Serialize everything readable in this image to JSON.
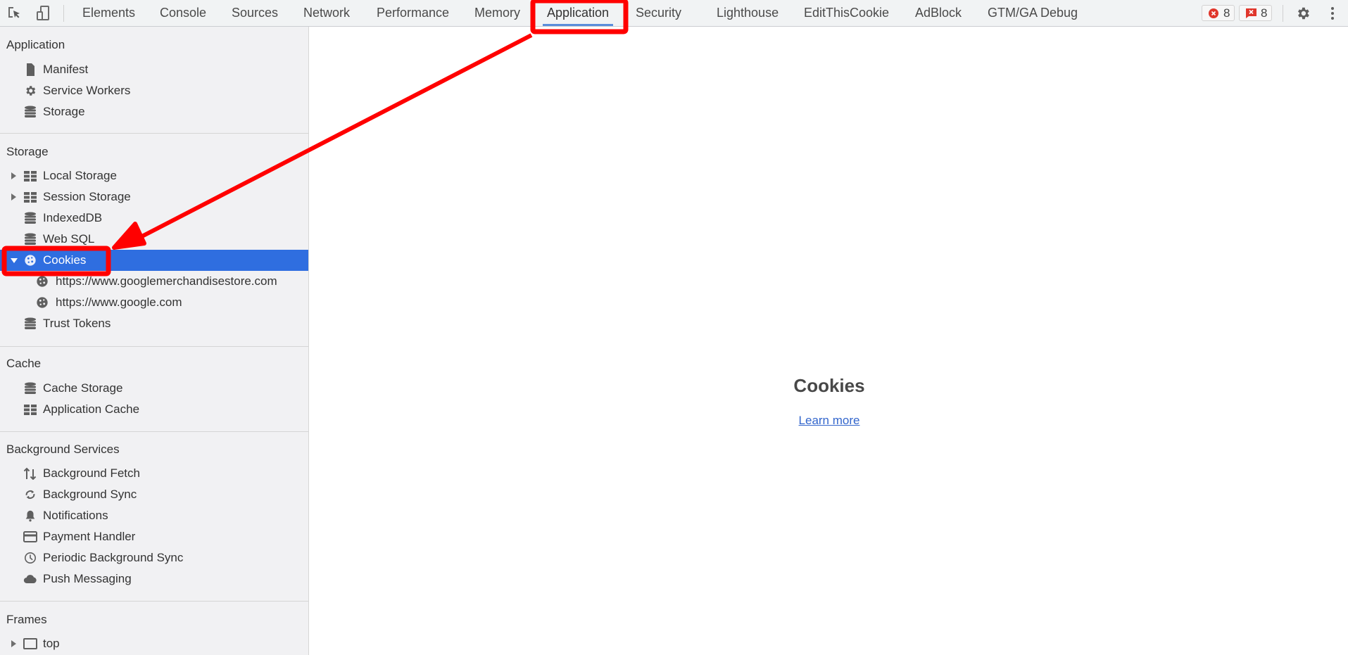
{
  "toolbar": {
    "inspect_icon": "inspect-element-icon",
    "device_icon": "device-toolbar-icon",
    "tabs": [
      {
        "label": "Elements"
      },
      {
        "label": "Console"
      },
      {
        "label": "Sources"
      },
      {
        "label": "Network"
      },
      {
        "label": "Performance"
      },
      {
        "label": "Memory"
      },
      {
        "label": "Application",
        "active": true
      },
      {
        "label": "Security"
      },
      {
        "label": "Lighthouse"
      },
      {
        "label": "EditThisCookie"
      },
      {
        "label": "AdBlock"
      },
      {
        "label": "GTM/GA Debug"
      }
    ],
    "error_count": "8",
    "issue_count": "8",
    "settings_icon": "gear-icon",
    "more_icon": "kebab-menu-icon"
  },
  "sidebar": {
    "sections": [
      {
        "header": "Application",
        "items": [
          {
            "label": "Manifest",
            "icon": "file-icon"
          },
          {
            "label": "Service Workers",
            "icon": "gear-icon"
          },
          {
            "label": "Storage",
            "icon": "database-icon"
          }
        ]
      },
      {
        "header": "Storage",
        "items": [
          {
            "label": "Local Storage",
            "icon": "grid-icon",
            "expandable": true
          },
          {
            "label": "Session Storage",
            "icon": "grid-icon",
            "expandable": true
          },
          {
            "label": "IndexedDB",
            "icon": "database-icon"
          },
          {
            "label": "Web SQL",
            "icon": "database-icon"
          },
          {
            "label": "Cookies",
            "icon": "cookie-icon",
            "expandable": true,
            "expanded": true,
            "selected": true
          },
          {
            "label": "https://www.googlemerchandisestore.com",
            "icon": "cookie-icon",
            "child": true
          },
          {
            "label": "https://www.google.com",
            "icon": "cookie-icon",
            "child": true
          },
          {
            "label": "Trust Tokens",
            "icon": "database-icon"
          }
        ]
      },
      {
        "header": "Cache",
        "items": [
          {
            "label": "Cache Storage",
            "icon": "database-icon"
          },
          {
            "label": "Application Cache",
            "icon": "grid-icon"
          }
        ]
      },
      {
        "header": "Background Services",
        "items": [
          {
            "label": "Background Fetch",
            "icon": "up-down-arrows-icon"
          },
          {
            "label": "Background Sync",
            "icon": "sync-icon"
          },
          {
            "label": "Notifications",
            "icon": "bell-icon"
          },
          {
            "label": "Payment Handler",
            "icon": "credit-card-icon"
          },
          {
            "label": "Periodic Background Sync",
            "icon": "clock-icon"
          },
          {
            "label": "Push Messaging",
            "icon": "cloud-icon"
          }
        ]
      },
      {
        "header": "Frames",
        "items": [
          {
            "label": "top",
            "icon": "frame-icon",
            "expandable": true
          }
        ]
      }
    ]
  },
  "main": {
    "title": "Cookies",
    "learn_more": "Learn more"
  },
  "colors": {
    "selection": "#2f6ee0",
    "annotation": "#ff0000",
    "link": "#3366cc",
    "active_tab_underline": "#5a8ddb"
  }
}
